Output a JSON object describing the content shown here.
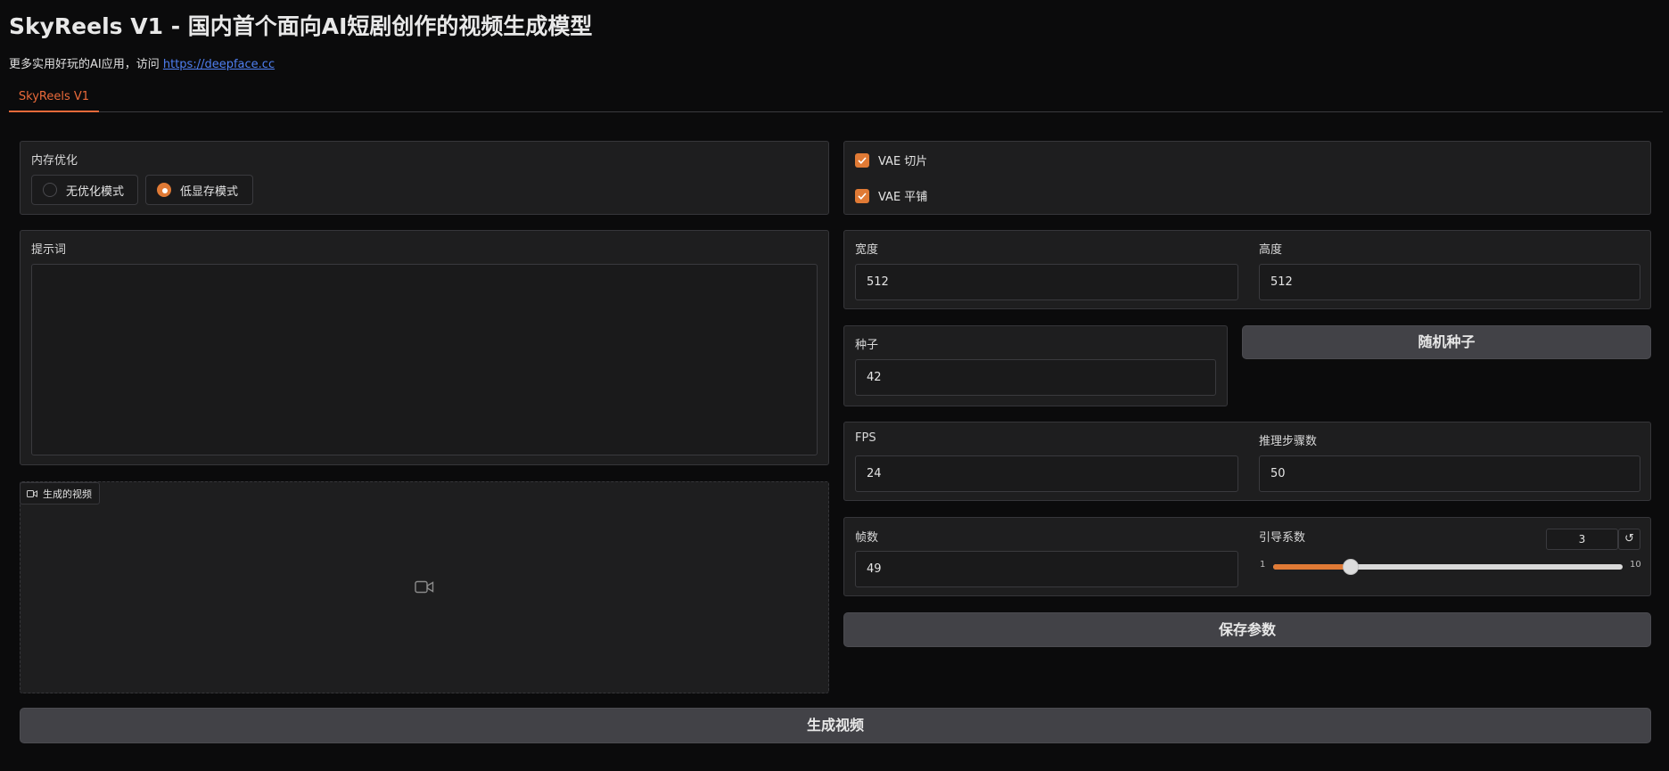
{
  "header": {
    "title": "SkyReels V1 - 国内首个面向AI短剧创作的视频生成模型",
    "subtitle_prefix": "更多实用好玩的AI应用，访问",
    "subtitle_link": "https://deepface.cc"
  },
  "tabs": [
    {
      "label": "SkyReels V1",
      "active": true
    }
  ],
  "memory": {
    "label": "内存优化",
    "options": [
      {
        "label": "无优化模式",
        "selected": false
      },
      {
        "label": "低显存模式",
        "selected": true
      }
    ]
  },
  "prompt": {
    "label": "提示词",
    "value": "",
    "placeholder": ""
  },
  "video": {
    "label": "生成的视频",
    "icon": "video-camera-icon"
  },
  "vae": {
    "tiling_label": "VAE 切片",
    "tiling_checked": true,
    "tile_label": "VAE 平铺",
    "tile_checked": true
  },
  "size": {
    "width_label": "宽度",
    "width_value": "512",
    "height_label": "高度",
    "height_value": "512"
  },
  "seed": {
    "label": "种子",
    "value": "42",
    "random_button": "随机种子"
  },
  "params": {
    "fps_label": "FPS",
    "fps_value": "24",
    "steps_label": "推理步骤数",
    "steps_value": "50",
    "frames_label": "帧数",
    "frames_value": "49",
    "guidance_label": "引导系数",
    "guidance_value": "3",
    "guidance_min": "1",
    "guidance_max": "10",
    "guidance_fraction": 0.222
  },
  "buttons": {
    "save": "保存参数",
    "generate": "生成视频"
  },
  "colors": {
    "accent": "#e07a35",
    "background": "#0b0b0c",
    "panel": "#1e1e1f",
    "link": "#4f7ff1"
  }
}
